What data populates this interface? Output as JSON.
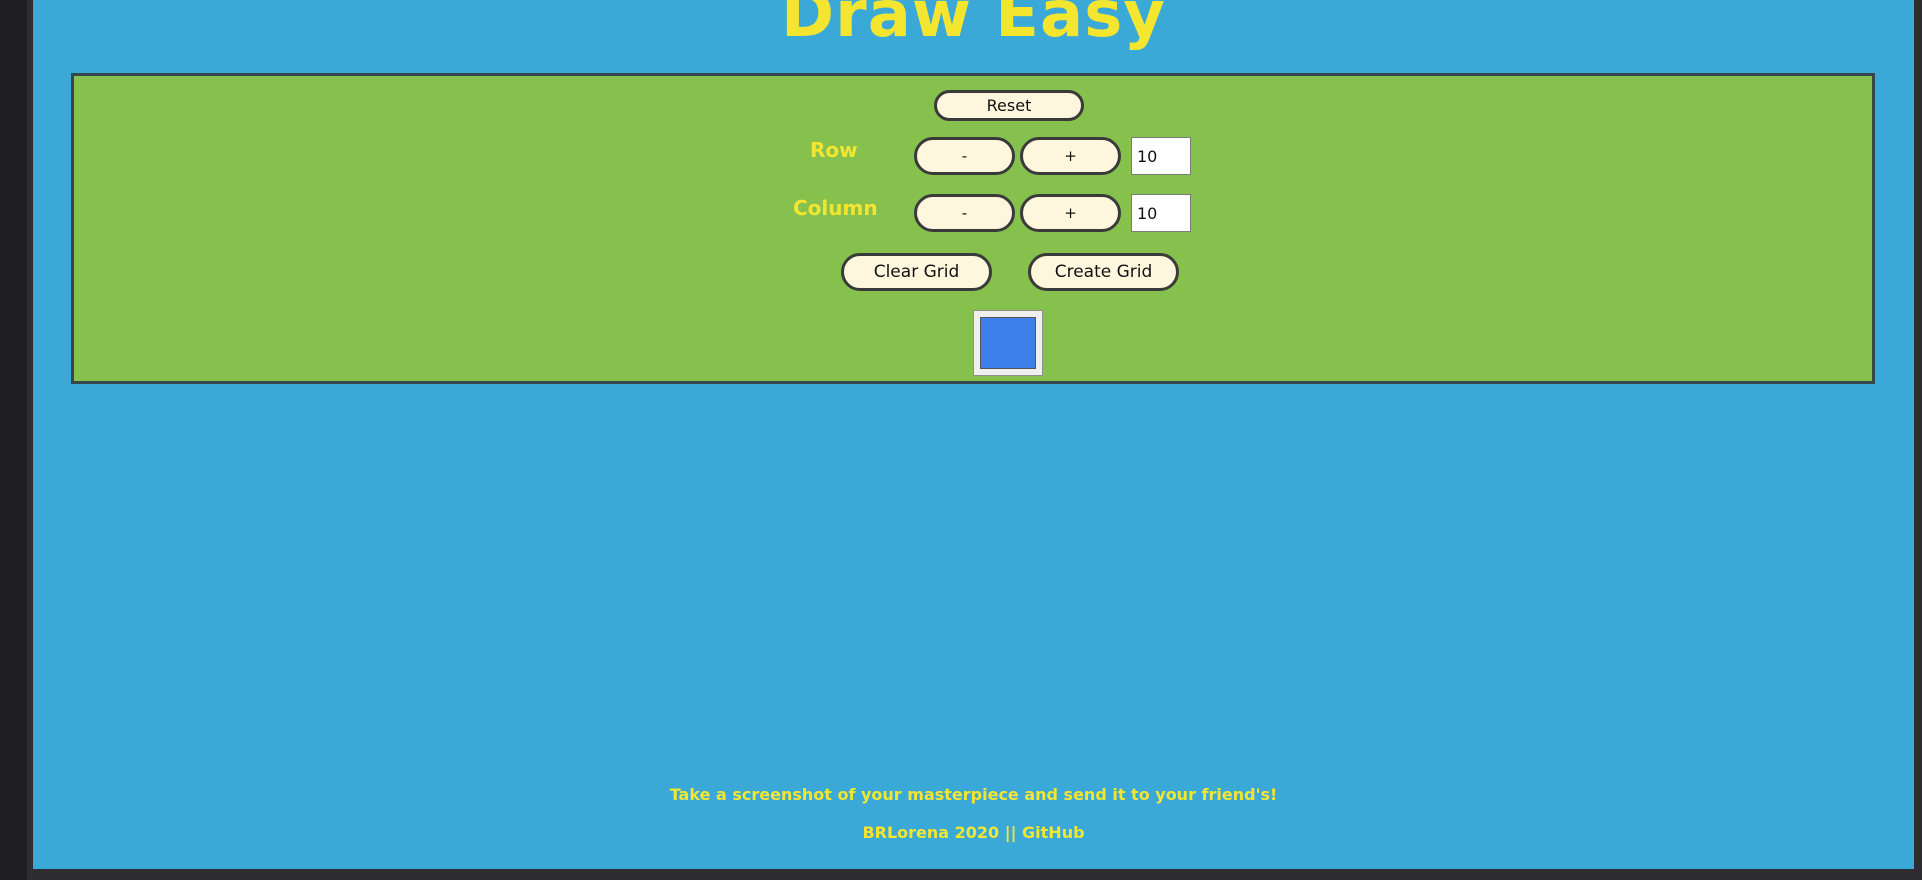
{
  "app": {
    "title": "Draw Easy"
  },
  "controls": {
    "reset_label": "Reset",
    "row": {
      "label": "Row",
      "minus_label": "-",
      "plus_label": "+",
      "value": "10"
    },
    "column": {
      "label": "Column",
      "minus_label": "-",
      "plus_label": "+",
      "value": "10"
    },
    "clear_grid_label": "Clear Grid",
    "create_grid_label": "Create Grid",
    "color_picker": {
      "value": "#3d80ec"
    }
  },
  "footer": {
    "message": "Take a screenshot of your masterpiece and send it to your friend's!",
    "credit": "BRLorena 2020",
    "separator": "||",
    "link_label": "GitHub"
  },
  "colors": {
    "background": "#3aa9d8",
    "panel": "#86c04d",
    "accent_text": "#f4e52f",
    "button_fill": "#fef7de",
    "selected_color": "#3d80ec"
  }
}
